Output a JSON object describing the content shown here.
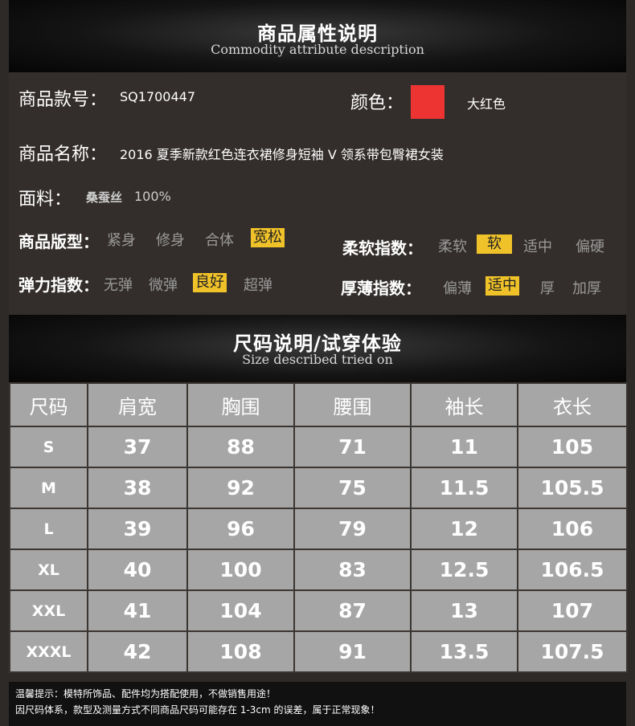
{
  "header": {
    "title_cn": "商品属性说明",
    "title_en": "Commodity attribute description"
  },
  "attributes": {
    "model_label": "商品款号：",
    "model_value": "SQ1700447",
    "color_label": "颜色：",
    "color_value": "大红色",
    "color_swatch": "#ee3333",
    "name_label": "商品名称：",
    "name_value": "2016 夏季新款红色连衣裙修身短袖 V 领系带包臀裙女装",
    "fabric_label": "面料：",
    "fabric_name": "桑蚕丝",
    "fabric_percent": "100%",
    "fit": {
      "label": "商品版型：",
      "options": [
        "紧身",
        "修身",
        "合体",
        "宽松"
      ],
      "selected": "宽松"
    },
    "softness": {
      "label": "柔软指数：",
      "options": [
        "柔软",
        "软",
        "适中",
        "偏硬"
      ],
      "selected": "软"
    },
    "elasticity": {
      "label": "弹力指数：",
      "options": [
        "无弹",
        "微弹",
        "良好",
        "超弹"
      ],
      "selected": "良好"
    },
    "thickness": {
      "label": "厚薄指数：",
      "options": [
        "偏薄",
        "适中",
        "厚",
        "加厚"
      ],
      "selected": "适中"
    }
  },
  "size_section": {
    "title_cn": "尺码说明/试穿体验",
    "title_en": "Size described tried on"
  },
  "size_table": {
    "columns": [
      "尺码",
      "肩宽",
      "胸围",
      "腰围",
      "袖长",
      "衣长"
    ],
    "rows": [
      [
        "S",
        "37",
        "88",
        "71",
        "11",
        "105"
      ],
      [
        "M",
        "38",
        "92",
        "75",
        "11.5",
        "105.5"
      ],
      [
        "L",
        "39",
        "96",
        "79",
        "12",
        "106"
      ],
      [
        "XL",
        "40",
        "100",
        "83",
        "12.5",
        "106.5"
      ],
      [
        "XXL",
        "41",
        "104",
        "87",
        "13",
        "107"
      ],
      [
        "XXXL",
        "42",
        "108",
        "91",
        "13.5",
        "107.5"
      ]
    ]
  },
  "notice": {
    "line1": "温馨提示：模特所饰品、配件均为搭配使用，不做销售用途！",
    "line2": "因尺码体系，款型及测量方式不同商品尺码可能存在 1-3cm 的误差，属于正常现象！"
  }
}
